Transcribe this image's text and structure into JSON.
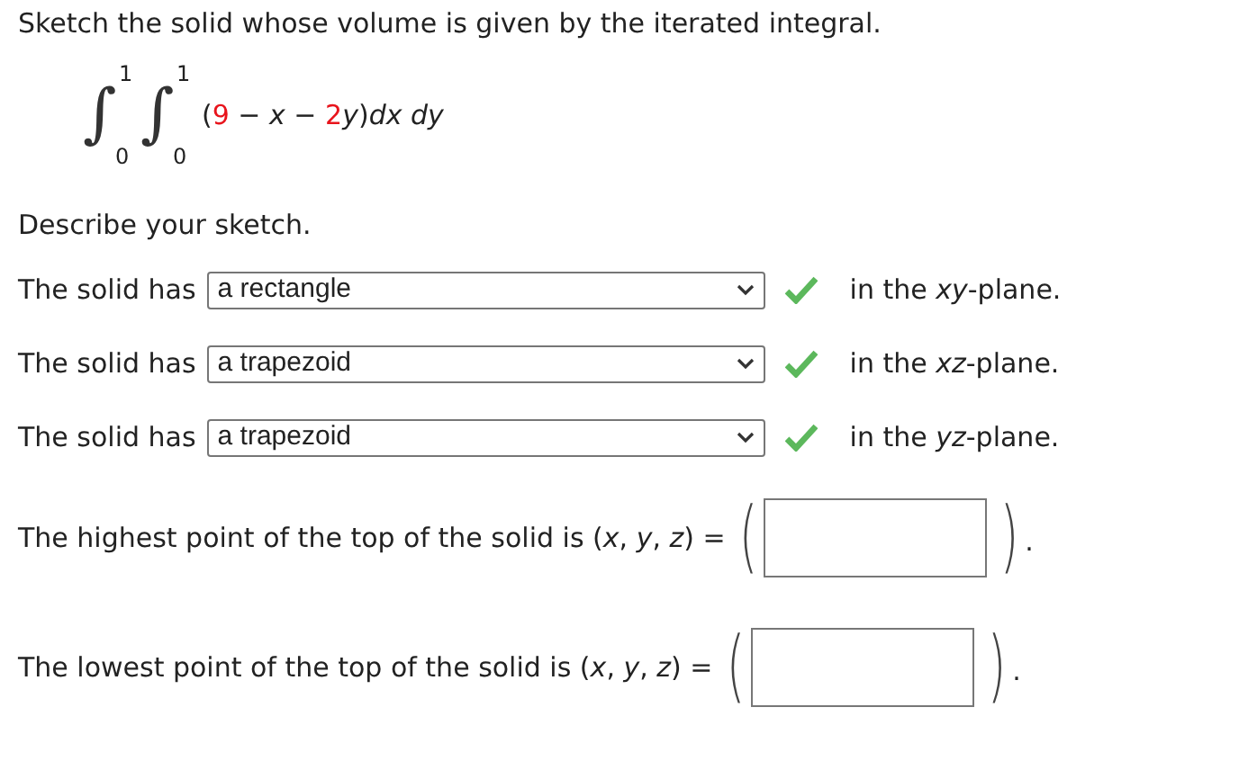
{
  "prompt": "Sketch the solid whose volume is given by the iterated integral.",
  "integral": {
    "outer": {
      "lower": "0",
      "upper": "1"
    },
    "inner": {
      "lower": "0",
      "upper": "1"
    },
    "sign": "∫",
    "integrand": [
      {
        "kind": "plain",
        "text": "("
      },
      {
        "kind": "given",
        "text": "9"
      },
      {
        "kind": "plain",
        "text": " − "
      },
      {
        "kind": "var",
        "text": "x"
      },
      {
        "kind": "plain",
        "text": " − "
      },
      {
        "kind": "given",
        "text": "2"
      },
      {
        "kind": "var",
        "text": "y"
      },
      {
        "kind": "plain",
        "text": ")"
      },
      {
        "kind": "var",
        "text": "dx dy"
      }
    ]
  },
  "describe": "Describe your sketch.",
  "rows": [
    {
      "prefix": "The solid has",
      "answer": "a rectangle",
      "correct": true,
      "suffix": "in the *xy*-plane."
    },
    {
      "prefix": "The solid has",
      "answer": "a trapezoid",
      "correct": true,
      "suffix": "in the *xz*-plane."
    },
    {
      "prefix": "The solid has",
      "answer": "a trapezoid",
      "correct": true,
      "suffix": "in the *yz*-plane."
    }
  ],
  "points": [
    {
      "question": "The highest point of the top of the solid is (*x*, *y*, *z*) =",
      "open": "(",
      "close": ")",
      "end": "."
    },
    {
      "question": "The lowest point of the top of the solid is (*x*, *y*, *z*) =",
      "open": "(",
      "close": ")",
      "end": "."
    }
  ]
}
